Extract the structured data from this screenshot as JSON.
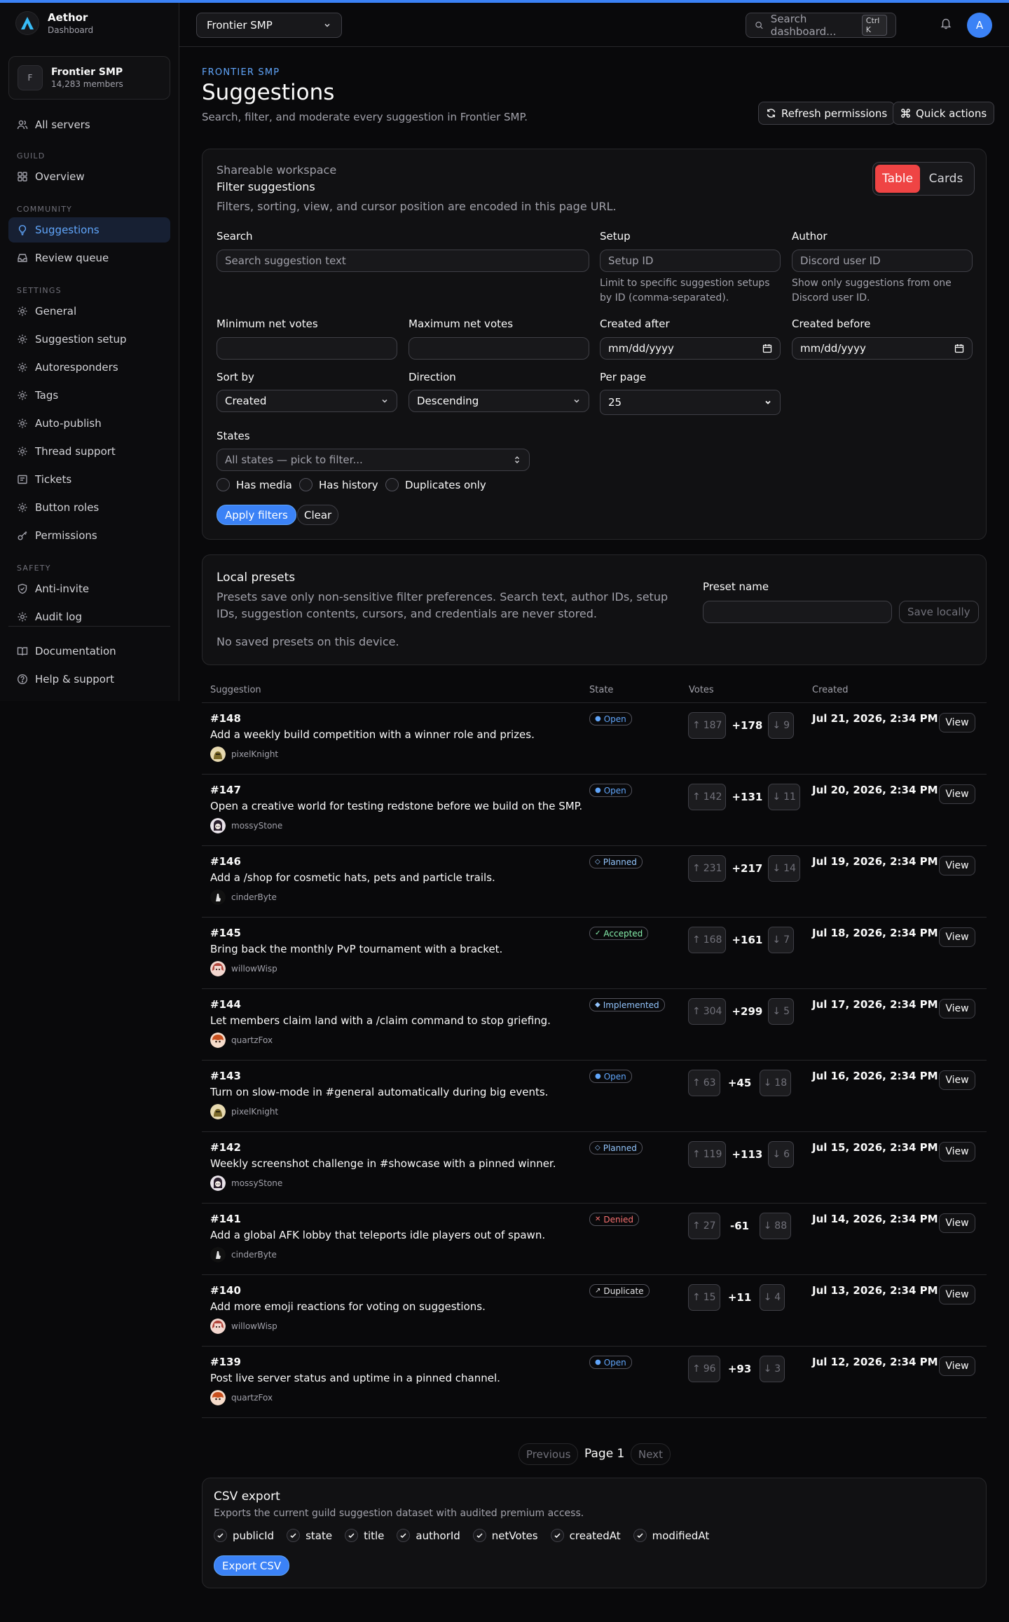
{
  "app": {
    "name": "Aethor",
    "subtitle": "Dashboard",
    "accent": "#3b82f6",
    "danger": "#ef4444"
  },
  "guild": {
    "name": "Frontier SMP",
    "initial": "F",
    "members": "14,283 members"
  },
  "user": {
    "initial": "A"
  },
  "sidebar": {
    "all_servers": "All servers",
    "sections": {
      "guild": "GUILD",
      "community": "COMMUNITY",
      "settings": "SETTINGS",
      "safety": "SAFETY"
    },
    "overview": "Overview",
    "suggestions": "Suggestions",
    "review_queue": "Review queue",
    "general": "General",
    "suggestion_setup": "Suggestion setup",
    "autoresponders": "Autoresponders",
    "tags": "Tags",
    "auto_publish": "Auto-publish",
    "thread_support": "Thread support",
    "tickets": "Tickets",
    "button_roles": "Button roles",
    "permissions": "Permissions",
    "anti_invite": "Anti-invite",
    "audit_log": "Audit log",
    "documentation": "Documentation",
    "help": "Help & support"
  },
  "topbar": {
    "guild_select": "Frontier SMP",
    "search_placeholder": "Search dashboard...",
    "shortcut": "Ctrl K"
  },
  "page": {
    "eyebrow": "FRONTIER SMP",
    "title": "Suggestions",
    "description": "Search, filter, and moderate every suggestion in Frontier SMP.",
    "refresh_label": "Refresh permissions",
    "quick_actions_label": "Quick actions"
  },
  "filters": {
    "workspace_label": "Shareable workspace",
    "heading": "Filter suggestions",
    "description": "Filters, sorting, view, and cursor position are encoded in this page URL.",
    "view_table": "Table",
    "view_cards": "Cards",
    "search_label": "Search",
    "search_placeholder": "Search suggestion text",
    "setup_label": "Setup",
    "setup_placeholder": "Setup ID",
    "setup_hint": "Limit to specific suggestion setups by ID (comma-separated).",
    "author_label": "Author",
    "author_placeholder": "Discord user ID",
    "author_hint": "Show only suggestions from one Discord user ID.",
    "min_votes_label": "Minimum net votes",
    "max_votes_label": "Maximum net votes",
    "created_after_label": "Created after",
    "created_before_label": "Created before",
    "date_placeholder": "mm/dd/yyyy",
    "sort_label": "Sort by",
    "sort_value": "Created",
    "direction_label": "Direction",
    "direction_value": "Descending",
    "per_page_label": "Per page",
    "per_page_value": "25",
    "states_label": "States",
    "states_placeholder": "All states — pick to filter...",
    "has_media": "Has media",
    "has_history": "Has history",
    "duplicates_only": "Duplicates only",
    "apply_label": "Apply filters",
    "clear_label": "Clear"
  },
  "presets": {
    "heading": "Local presets",
    "description": "Presets save only non-sensitive filter preferences. Search text, author IDs, setup IDs, suggestion contents, cursors, and credentials are never stored.",
    "empty": "No saved presets on this device.",
    "name_label": "Preset name",
    "save_label": "Save locally"
  },
  "table": {
    "columns": {
      "suggestion": "Suggestion",
      "state": "State",
      "votes": "Votes",
      "created": "Created"
    },
    "view_label": "View",
    "rows": [
      {
        "id": "#148",
        "title": "Add a weekly build competition with a winner role and prizes.",
        "author": "pixelKnight",
        "avatar": "knight",
        "state": "Open",
        "state_icon": "●",
        "state_color": "#60a5fa",
        "up": "187",
        "net": "+178",
        "down": "9",
        "created": "Jul 21, 2026, 2:34 PM"
      },
      {
        "id": "#147",
        "title": "Open a creative world for testing redstone before we build on the SMP.",
        "author": "mossyStone",
        "avatar": "ghost",
        "state": "Open",
        "state_icon": "●",
        "state_color": "#60a5fa",
        "up": "142",
        "net": "+131",
        "down": "11",
        "created": "Jul 20, 2026, 2:34 PM"
      },
      {
        "id": "#146",
        "title": "Add a /shop for cosmetic hats, pets and particle trails.",
        "author": "cinderByte",
        "avatar": "hand",
        "state": "Planned",
        "state_icon": "◇",
        "state_color": "#93c5fd",
        "up": "231",
        "net": "+217",
        "down": "14",
        "created": "Jul 19, 2026, 2:34 PM"
      },
      {
        "id": "#145",
        "title": "Bring back the monthly PvP tournament with a bracket.",
        "author": "willowWisp",
        "avatar": "girl",
        "state": "Accepted",
        "state_icon": "✓",
        "state_color": "#86efac",
        "up": "168",
        "net": "+161",
        "down": "7",
        "created": "Jul 18, 2026, 2:34 PM"
      },
      {
        "id": "#144",
        "title": "Let members claim land with a /claim command to stop griefing.",
        "author": "quartzFox",
        "avatar": "fox",
        "state": "Implemented",
        "state_icon": "◆",
        "state_color": "#93c5fd",
        "up": "304",
        "net": "+299",
        "down": "5",
        "created": "Jul 17, 2026, 2:34 PM"
      },
      {
        "id": "#143",
        "title": "Turn on slow-mode in #general automatically during big events.",
        "author": "pixelKnight",
        "avatar": "knight",
        "state": "Open",
        "state_icon": "●",
        "state_color": "#60a5fa",
        "up": "63",
        "net": "+45",
        "down": "18",
        "created": "Jul 16, 2026, 2:34 PM"
      },
      {
        "id": "#142",
        "title": "Weekly screenshot challenge in #showcase with a pinned winner.",
        "author": "mossyStone",
        "avatar": "ghost",
        "state": "Planned",
        "state_icon": "◇",
        "state_color": "#93c5fd",
        "up": "119",
        "net": "+113",
        "down": "6",
        "created": "Jul 15, 2026, 2:34 PM"
      },
      {
        "id": "#141",
        "title": "Add a global AFK lobby that teleports idle players out of spawn.",
        "author": "cinderByte",
        "avatar": "hand",
        "state": "Denied",
        "state_icon": "✕",
        "state_color": "#f87171",
        "up": "27",
        "net": "-61",
        "down": "88",
        "created": "Jul 14, 2026, 2:34 PM"
      },
      {
        "id": "#140",
        "title": "Add more emoji reactions for voting on suggestions.",
        "author": "willowWisp",
        "avatar": "girl",
        "state": "Duplicate",
        "state_icon": "↗",
        "state_color": "#e4e4e7",
        "up": "15",
        "net": "+11",
        "down": "4",
        "created": "Jul 13, 2026, 2:34 PM"
      },
      {
        "id": "#139",
        "title": "Post live server status and uptime in a pinned channel.",
        "author": "quartzFox",
        "avatar": "fox",
        "state": "Open",
        "state_icon": "●",
        "state_color": "#60a5fa",
        "up": "96",
        "net": "+93",
        "down": "3",
        "created": "Jul 12, 2026, 2:34 PM"
      }
    ]
  },
  "pagination": {
    "previous": "Previous",
    "page": "Page 1",
    "next": "Next"
  },
  "csv": {
    "heading": "CSV export",
    "description": "Exports the current guild suggestion dataset with audited premium access.",
    "columns": [
      "publicId",
      "state",
      "title",
      "authorId",
      "netVotes",
      "createdAt",
      "modifiedAt"
    ],
    "export_label": "Export CSV"
  }
}
